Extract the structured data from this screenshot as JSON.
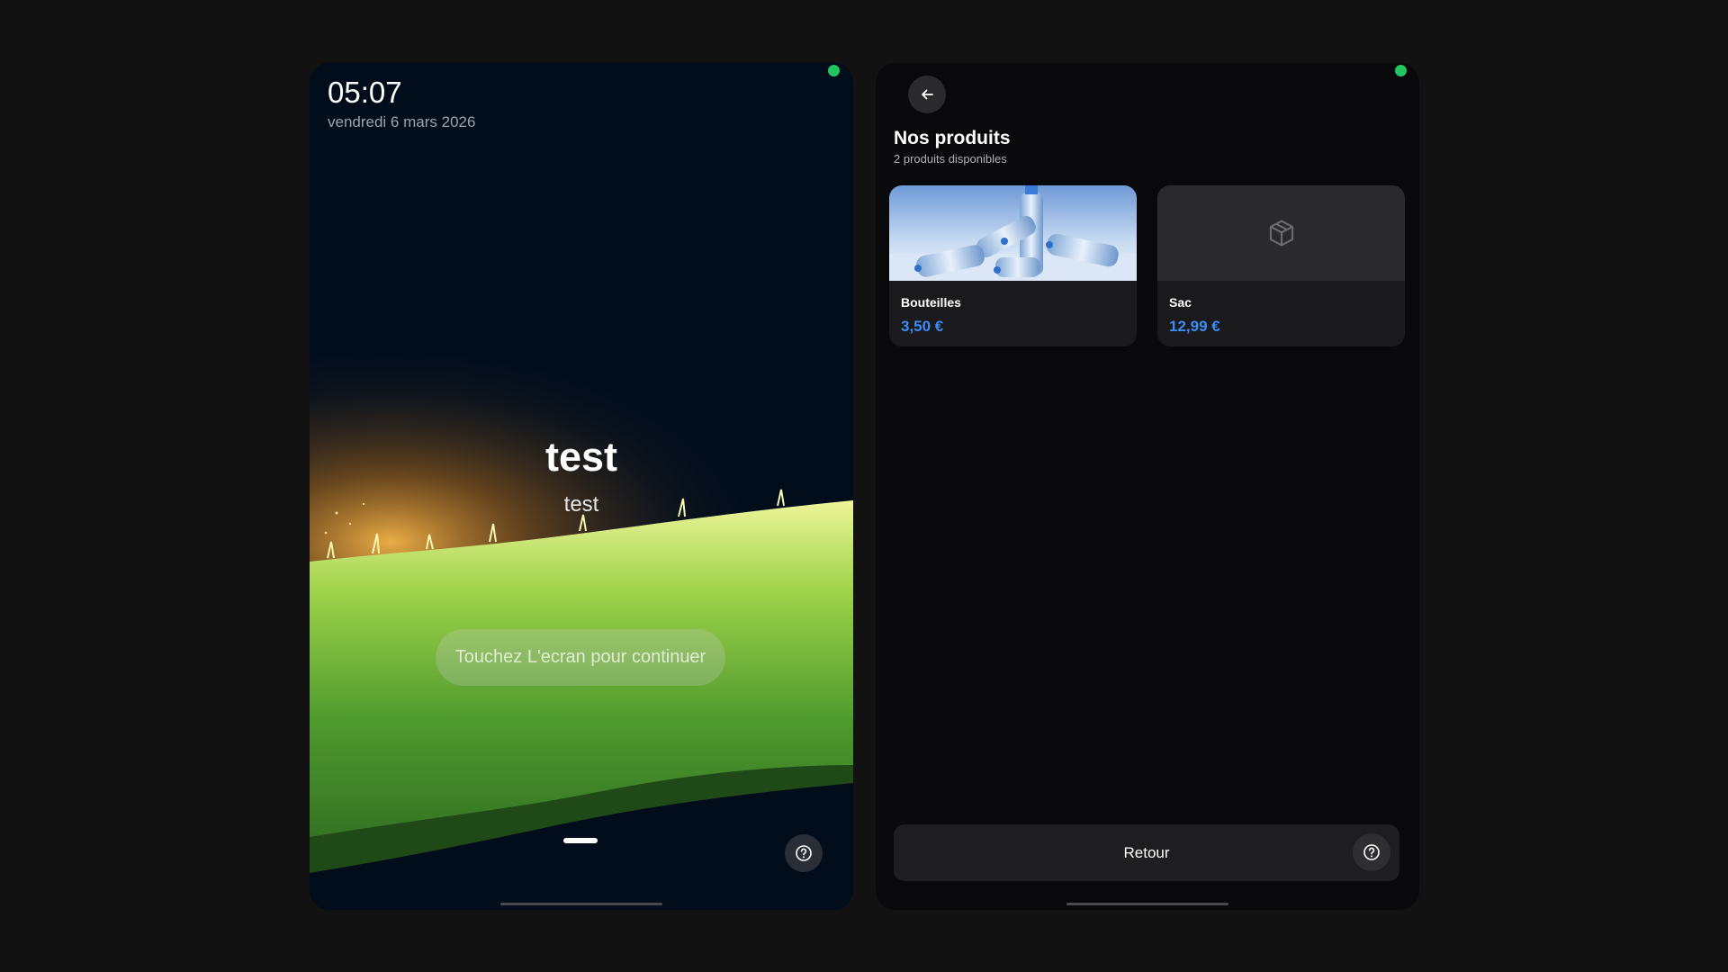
{
  "status": {
    "indicator_color": "#22c55e"
  },
  "lock_screen": {
    "time": "05:07",
    "date": "vendredi 6 mars 2026",
    "title": "test",
    "subtitle": "test",
    "continue_label": "Touchez L'ecran pour continuer",
    "help_icon": "help-circle-icon"
  },
  "shop": {
    "back_icon": "arrow-left-icon",
    "title": "Nos produits",
    "subtitle": "2 produits disponibles",
    "products": [
      {
        "name": "Bouteilles",
        "price": "3,50 €",
        "image": "water-bottles-photo"
      },
      {
        "name": "Sac",
        "price": "12,99 €",
        "image": "package-icon"
      }
    ],
    "footer": {
      "back_label": "Retour",
      "help_icon": "help-circle-icon"
    },
    "accent": "#3b8cf7"
  }
}
